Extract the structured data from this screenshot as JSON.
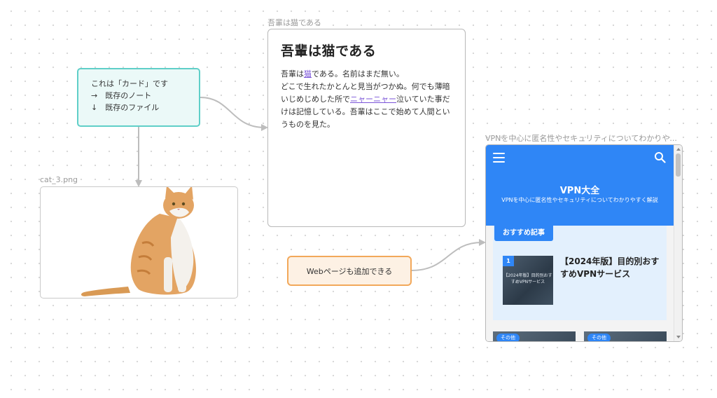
{
  "canvas": {
    "cards": {
      "teal": {
        "lines": [
          "これは「カード」です",
          "→　既存のノート",
          "↓　既存のファイル"
        ]
      },
      "orange": {
        "text": "Webページも追加できる"
      }
    },
    "image_node": {
      "title": "cat_3.png"
    },
    "note_node": {
      "title": "吾輩は猫である",
      "heading": "吾輩は猫である",
      "body": {
        "p1_before": "吾輩は",
        "p1_link": "猫",
        "p1_after": "である。名前はまだ無い。",
        "p2_before": "どこで生れたかとんと見当がつかぬ。何でも薄暗いじめじめした所で",
        "p2_link": "ニャーニャー",
        "p2_after": "泣いていた事だけは記憶している。吾輩はここで始めて人間というものを見た。"
      }
    },
    "web_node": {
      "title": "VPNを中心に匿名性やセキュリティについてわかりや...",
      "site_title": "VPN大全",
      "site_subtitle": "VPNを中心に匿名性やセキュリティについてわかりやすく解説",
      "section_label": "おすすめ記事",
      "article": {
        "rank": "1",
        "thumb_text": "【2024年版】目的別おすすめVPNサービス",
        "title": "【2024年版】目的別おすすめVPNサービス"
      },
      "mini_cards": [
        {
          "badge": "その他"
        },
        {
          "badge": "その他"
        }
      ]
    }
  },
  "colors": {
    "teal_border": "#5fcfc8",
    "orange_border": "#f2a85a",
    "site_blue": "#2f86f6",
    "link_purple": "#7b55d8",
    "connector_gray": "#bdbdbd"
  }
}
